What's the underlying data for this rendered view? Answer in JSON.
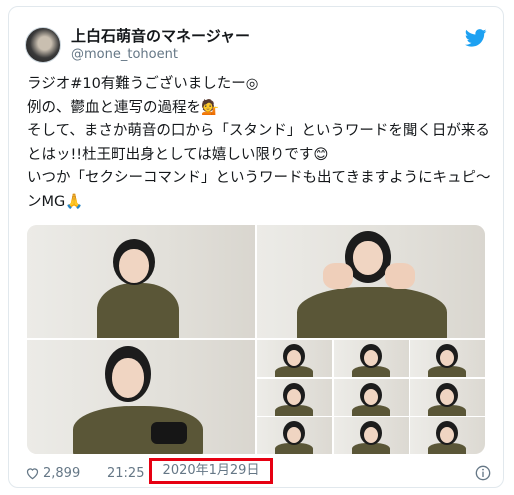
{
  "tweet": {
    "display_name": "上白石萌音のマネージャー",
    "handle": "@mone_tohoent",
    "text": "ラジオ#10有難うございましたー◎\n例の、鬱血と連写の過程を💁\nそして、まさか萌音の口から「スタンド」というワードを聞く日が来るとはッ!!杜王町出身としては嬉しい限りです😊\nいつか「セクシーコマンド」というワードも出てきますようにキュピ〜ンMG🙏"
  },
  "footer": {
    "likes": "2,899",
    "time": "21:25",
    "date": "2020年1月29日"
  },
  "colors": {
    "twitter_blue": "#1da1f2",
    "highlight_red": "#e60012",
    "muted_text": "#657786"
  },
  "icons": [
    "twitter-bird-icon",
    "heart-icon",
    "info-icon"
  ]
}
